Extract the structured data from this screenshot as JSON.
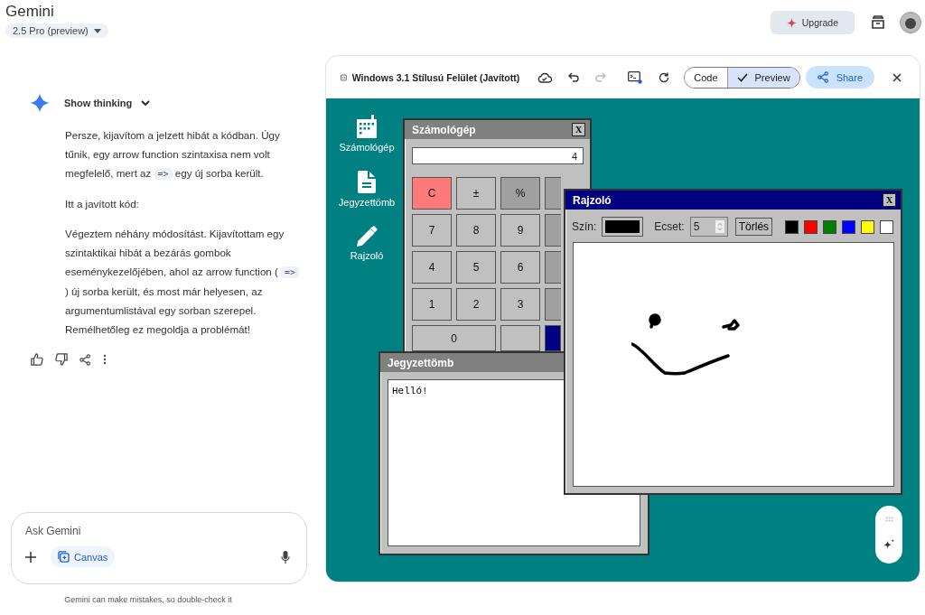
{
  "app": {
    "title": "Gemini",
    "model": "2.5 Pro (preview)",
    "upgrade": "Upgrade"
  },
  "chat": {
    "thinking": "Show thinking",
    "paragraphs": [
      [
        {
          "kind": "text",
          "text": "Persze, kijavítom a jelzett hibát a kódban. Úgy tűnik, egy arrow function szintaxisa nem volt megfelelő, mert az "
        },
        {
          "kind": "code",
          "text": "=>"
        },
        {
          "kind": "text",
          "text": " egy új sorba került."
        }
      ],
      [
        {
          "kind": "text",
          "text": "Itt a javított kód:"
        }
      ],
      [
        {
          "kind": "text",
          "text": "Végeztem néhány módosítást. Kijavítottam egy szintaktikai hibát a bezárás gombok eseménykezelőjében, ahol az arrow function ( "
        },
        {
          "kind": "code",
          "text": "=>"
        },
        {
          "kind": "text",
          "text": " ) új sorba került, és most már helyesen, az argumentumlistával egy sorban szerepel. Remélhetőleg ez megoldja a problémát!"
        }
      ]
    ],
    "input": {
      "placeholder": "Ask Gemini",
      "tool": {
        "label": "Canvas",
        "selected": true
      }
    },
    "disclaimer": "Gemini can make mistakes, so double-check it"
  },
  "canvas": {
    "title": "Windows 3.1 Stílusú Felület (Javított)",
    "history": [
      {
        "kind": "undo",
        "disabled": false
      },
      {
        "kind": "redo",
        "disabled": true
      }
    ],
    "view_toggle": [
      {
        "label": "Code",
        "selected": false
      },
      {
        "label": "Preview",
        "selected": true
      }
    ],
    "share": "Share",
    "desktop": {
      "icons": [
        {
          "kind": "calculator",
          "label": "Számológép"
        },
        {
          "kind": "notepad",
          "label": "Jegyzettömb"
        },
        {
          "kind": "pencil",
          "label": "Rajzoló"
        }
      ],
      "windows": [
        {
          "kind": "calculator",
          "title": "Számológép",
          "active": false,
          "close": "X",
          "display": "4",
          "buttons": [
            {
              "kind": "clear",
              "label": "C"
            },
            {
              "kind": "func",
              "label": "±"
            },
            {
              "kind": "op",
              "label": "%"
            },
            {
              "kind": "op"
            },
            {
              "kind": "digit",
              "label": "7"
            },
            {
              "kind": "digit",
              "label": "8"
            },
            {
              "kind": "digit",
              "label": "9"
            },
            {
              "kind": "op"
            },
            {
              "kind": "digit",
              "label": "4"
            },
            {
              "kind": "digit",
              "label": "5"
            },
            {
              "kind": "digit",
              "label": "6"
            },
            {
              "kind": "op"
            },
            {
              "kind": "digit",
              "label": "1"
            },
            {
              "kind": "digit",
              "label": "2"
            },
            {
              "kind": "digit",
              "label": "3"
            },
            {
              "kind": "op"
            },
            {
              "kind": "digit",
              "label": "0",
              "wide": true
            },
            {
              "kind": "digit"
            },
            {
              "kind": "equals"
            }
          ]
        },
        {
          "kind": "notepad",
          "title": "Jegyzettömb",
          "active": false,
          "text": "Helló!"
        },
        {
          "kind": "paint",
          "title": "Rajzoló",
          "active": true,
          "close": "X",
          "color_label": "Szín:",
          "brush_label": "Ecset:",
          "brush_size": "5",
          "clear": "Törlés",
          "palette": [
            {
              "color": "#000000"
            },
            {
              "color": "#ff0000"
            },
            {
              "color": "#008000"
            },
            {
              "color": "#0000ff"
            },
            {
              "color": "#ffff00"
            },
            {
              "color": "#ffffff"
            }
          ]
        }
      ]
    }
  }
}
